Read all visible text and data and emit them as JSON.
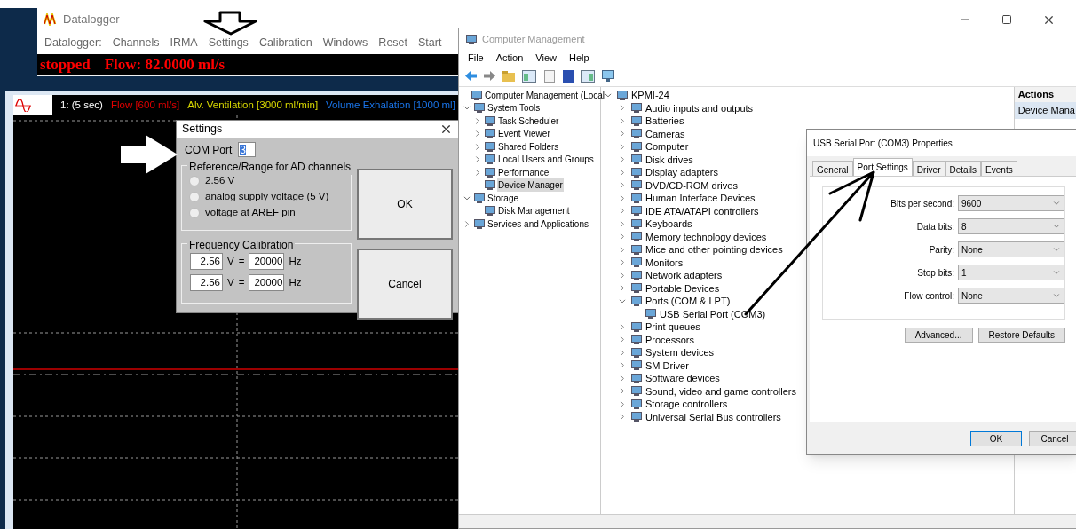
{
  "datalogger": {
    "title": "Datalogger",
    "menu": [
      "Datalogger:",
      "Channels",
      "IRMA",
      "Settings",
      "Calibration",
      "Windows",
      "Reset",
      "Start"
    ],
    "status": [
      "stopped",
      "Flow: 82.0000 ml/s"
    ]
  },
  "chart_window": {
    "legend": [
      {
        "text": "1: (5 sec)",
        "color": "#ffffff"
      },
      {
        "text": "Flow [600 ml/s]",
        "color": "#e00000"
      },
      {
        "text": "Alv. Ventilation [3000 ml/min]",
        "color": "#d8d800"
      },
      {
        "text": "Volume Exhalation [1000 ml]",
        "color": "#1a74e8"
      }
    ]
  },
  "settings_dialog": {
    "title": "Settings",
    "com_port_label": "COM Port",
    "com_port_value": "3",
    "reference_group": {
      "title": "Reference/Range for AD channels",
      "options": [
        {
          "label": "2.56 V",
          "selected": false
        },
        {
          "label": "analog supply voltage (5 V)",
          "selected": false
        },
        {
          "label": "voltage at AREF pin",
          "selected": false
        }
      ]
    },
    "frequency_group": {
      "title": "Frequency Calibration",
      "rows": [
        {
          "volts": "2.56",
          "v_unit": "V",
          "equals": "=",
          "hertz": "20000",
          "hz_unit": "Hz"
        },
        {
          "volts": "2.56",
          "v_unit": "V",
          "equals": "=",
          "hertz": "20000",
          "hz_unit": "Hz"
        }
      ]
    },
    "buttons": [
      "OK",
      "Cancel"
    ]
  },
  "computer_management": {
    "title": "Computer Management",
    "menu": [
      "File",
      "Action",
      "View",
      "Help"
    ],
    "tree": [
      {
        "label": "Computer Management (Local",
        "selected": false,
        "children": [
          {
            "label": "System Tools",
            "selected": false,
            "expanded": true,
            "children": [
              {
                "label": "Task Scheduler",
                "selected": false,
                "expanded": false
              },
              {
                "label": "Event Viewer",
                "selected": false,
                "expanded": false
              },
              {
                "label": "Shared Folders",
                "selected": false,
                "expanded": false
              },
              {
                "label": "Local Users and Groups",
                "selected": false,
                "expanded": false
              },
              {
                "label": "Performance",
                "selected": false,
                "expanded": false
              },
              {
                "label": "Device Manager",
                "selected": true
              }
            ]
          },
          {
            "label": "Storage",
            "selected": false,
            "expanded": true,
            "children": [
              {
                "label": "Disk Management",
                "selected": false
              }
            ]
          },
          {
            "label": "Services and Applications",
            "selected": false,
            "expanded": false
          }
        ]
      }
    ],
    "devices": {
      "label": "KPMI-24",
      "expanded": true,
      "children": [
        {
          "label": "Audio inputs and outputs",
          "expanded": false
        },
        {
          "label": "Batteries",
          "expanded": false
        },
        {
          "label": "Cameras",
          "expanded": false
        },
        {
          "label": "Computer",
          "expanded": false
        },
        {
          "label": "Disk drives",
          "expanded": false
        },
        {
          "label": "Display adapters",
          "expanded": false
        },
        {
          "label": "DVD/CD-ROM drives",
          "expanded": false
        },
        {
          "label": "Human Interface Devices",
          "expanded": false
        },
        {
          "label": "IDE ATA/ATAPI controllers",
          "expanded": false
        },
        {
          "label": "Keyboards",
          "expanded": false
        },
        {
          "label": "Memory technology devices",
          "expanded": false
        },
        {
          "label": "Mice and other pointing devices",
          "expanded": false
        },
        {
          "label": "Monitors",
          "expanded": false
        },
        {
          "label": "Network adapters",
          "expanded": false
        },
        {
          "label": "Portable Devices",
          "expanded": false
        },
        {
          "label": "Ports (COM & LPT)",
          "expanded": true,
          "children": [
            {
              "label": "USB Serial Port (COM3)"
            }
          ]
        },
        {
          "label": "Print queues",
          "expanded": false
        },
        {
          "label": "Processors",
          "expanded": false
        },
        {
          "label": "System devices",
          "expanded": false
        },
        {
          "label": "SM Driver",
          "expanded": false
        },
        {
          "label": "Software devices",
          "expanded": false
        },
        {
          "label": "Sound, video and game controllers",
          "expanded": false
        },
        {
          "label": "Storage controllers",
          "expanded": false
        },
        {
          "label": "Universal Serial Bus controllers",
          "expanded": false
        }
      ]
    },
    "actions": {
      "title": "Actions",
      "item": "Device Mana"
    }
  },
  "properties_dialog": {
    "title": "USB Serial Port (COM3) Properties",
    "tabs": [
      {
        "label": "General",
        "selected": false
      },
      {
        "label": "Port Settings",
        "selected": true
      },
      {
        "label": "Driver",
        "selected": false
      },
      {
        "label": "Details",
        "selected": false
      },
      {
        "label": "Events",
        "selected": false
      }
    ],
    "fields": [
      {
        "label": "Bits per second:",
        "value": "9600"
      },
      {
        "label": "Data bits:",
        "value": "8"
      },
      {
        "label": "Parity:",
        "value": "None"
      },
      {
        "label": "Stop bits:",
        "value": "1"
      },
      {
        "label": "Flow control:",
        "value": "None"
      }
    ],
    "buttons": [
      "Advanced...",
      "Restore Defaults"
    ],
    "footer_buttons": [
      "OK",
      "Cancel"
    ]
  }
}
